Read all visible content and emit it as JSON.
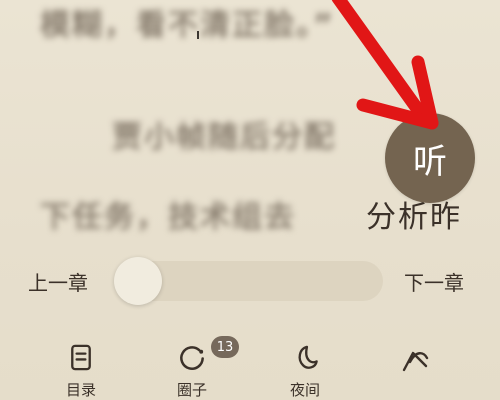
{
  "reader": {
    "blurred_lines": [
      "模糊，看不清正脸。”",
      "贾小帧随后分配",
      "下任务，技术组去"
    ],
    "clear_text": "分析昨"
  },
  "listen_button": {
    "label": "听"
  },
  "chapter_nav": {
    "prev_label": "上一章",
    "next_label": "下一章",
    "progress": 0.0
  },
  "toolbar": {
    "items": [
      {
        "label": "目录",
        "icon": "list-icon"
      },
      {
        "label": "圈子",
        "icon": "circle-icon",
        "badge": "13"
      },
      {
        "label": "夜间",
        "icon": "moon-icon"
      },
      {
        "label": "",
        "icon": "brightness-icon"
      }
    ]
  },
  "colors": {
    "background": "#e8e0cf",
    "listen_button": "#746450",
    "arrow": "#e11616",
    "badge": "#76695b",
    "slider_track": "#ddd4c0"
  }
}
